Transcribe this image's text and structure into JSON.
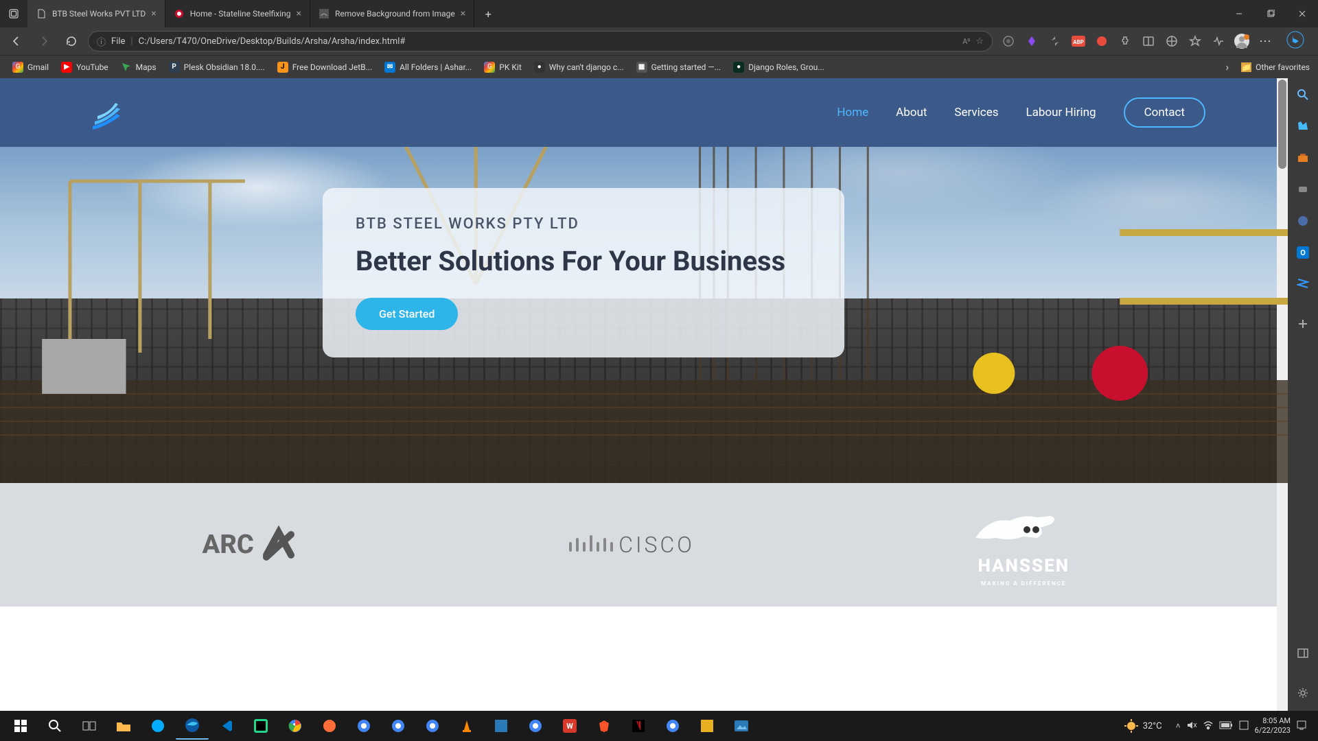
{
  "browser": {
    "tabs": [
      {
        "title": "BTB Steel Works PVT LTD",
        "active": true
      },
      {
        "title": "Home - Stateline Steelfixing",
        "active": false
      },
      {
        "title": "Remove Background from Image",
        "active": false
      }
    ],
    "url": "C:/Users/T470/OneDrive/Desktop/Builds/Arsha/Arsha/index.html#",
    "url_prefix": "File",
    "bookmarks": [
      {
        "label": "Gmail",
        "color": "#ea4335"
      },
      {
        "label": "YouTube",
        "color": "#ff0000"
      },
      {
        "label": "Maps",
        "color": "#34a853"
      },
      {
        "label": "Plesk Obsidian 18.0....",
        "color": "#2c3e50"
      },
      {
        "label": "Free Download JetB...",
        "color": "#f7941d"
      },
      {
        "label": "All Folders | Ashar...",
        "color": "#0078d4"
      },
      {
        "label": "PK Kit",
        "color": "#4285f4"
      },
      {
        "label": "Why can't django c...",
        "color": "#333"
      },
      {
        "label": "Getting started —...",
        "color": "#555"
      },
      {
        "label": "Django Roles, Grou...",
        "color": "#092e20"
      }
    ],
    "other_favorites": "Other favorites"
  },
  "site": {
    "nav": [
      {
        "label": "Home",
        "active": true
      },
      {
        "label": "About",
        "active": false
      },
      {
        "label": "Services",
        "active": false
      },
      {
        "label": "Labour Hiring",
        "active": false
      }
    ],
    "contact": "Contact",
    "hero": {
      "subtitle": "BTB STEEL WORKS PTY LTD",
      "title": "Better Solutions For Your Business",
      "cta": "Get Started"
    },
    "partners": [
      "ARC",
      "CISCO",
      "HANSSEN"
    ],
    "hanssen_tagline": "MAKING A DIFFERENCE"
  },
  "system": {
    "weather": "32°C",
    "time": "8:05 AM",
    "date": "6/22/2023"
  }
}
